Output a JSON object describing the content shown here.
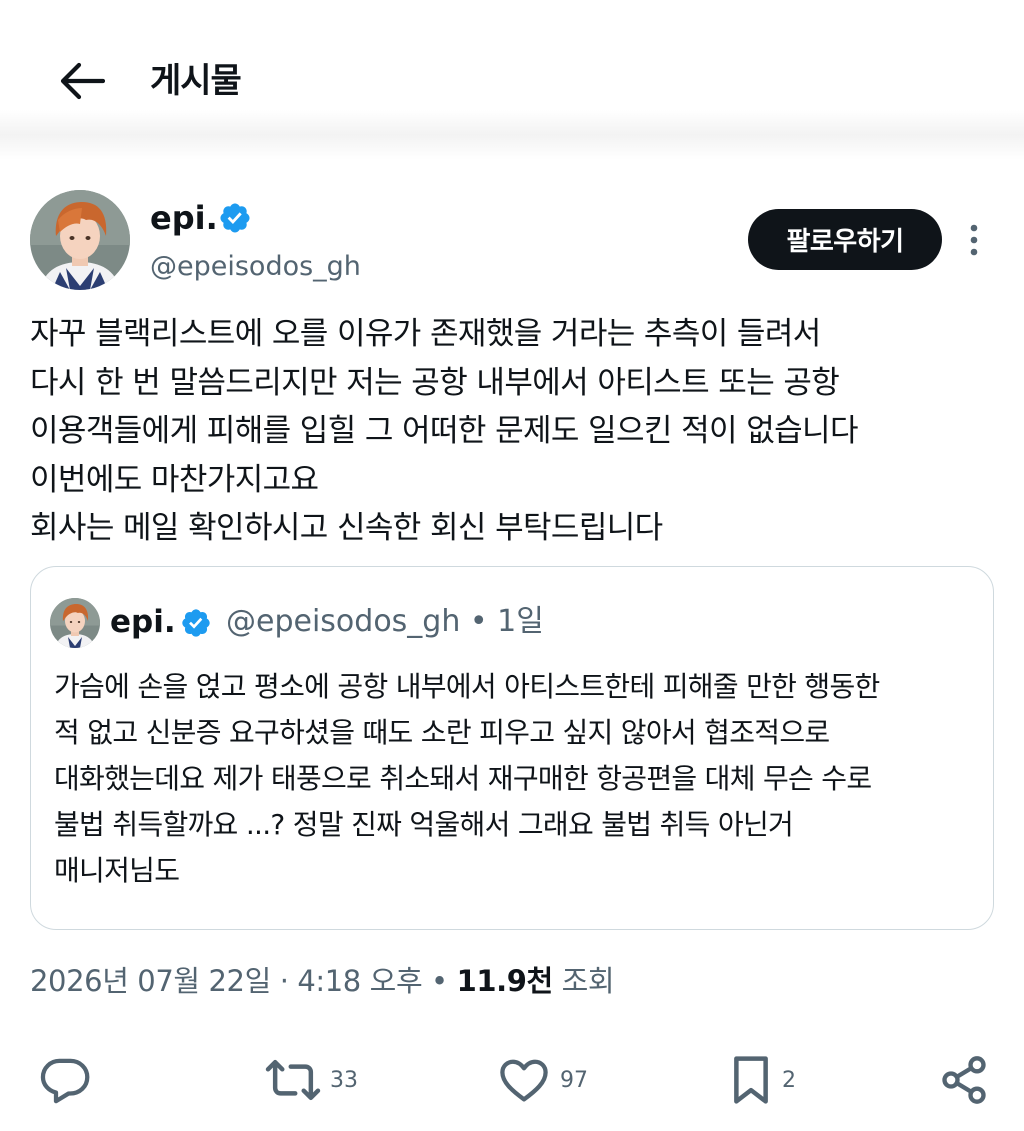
{
  "header": {
    "title": "게시물"
  },
  "author": {
    "display_name": "epi.",
    "handle": "@epeisodos_gh"
  },
  "follow_label": "팔로우하기",
  "tweet_lines": [
    "자꾸 블랙리스트에 오를 이유가 존재했을 거라는 추측이 들려서",
    "다시 한 번 말씀드리지만 저는 공항 내부에서 아티스트 또는 공항",
    "이용객들에게 피해를 입힐 그 어떠한 문제도 일으킨 적이 없습니다",
    "이번에도 마찬가지고요",
    "회사는 메일 확인하시고 신속한 회신 부탁드립니다"
  ],
  "quote": {
    "display_name": "epi.",
    "handle_time": "@epeisodos_gh • 1일",
    "lines": [
      "가슴에 손을 얹고 평소에 공항 내부에서 아티스트한테 피해줄 만한 행동한",
      "적 없고 신분증 요구하셨을 때도 소란 피우고 싶지 않아서 협조적으로",
      "대화했는데요 제가 태풍으로 취소돼서 재구매한 항공편을 대체 무슨 수로",
      "불법 취득할까요 ...? 정말 진짜 억울해서 그래요 불법 취득 아닌거",
      "매니저님도"
    ]
  },
  "meta": {
    "timestamp": "2026년 07월 22일 · 4:18 오후 • ",
    "views_count": "11.9천",
    "views_label": " 조회"
  },
  "actions": {
    "retweets": "33",
    "likes": "97",
    "bookmarks": "2"
  },
  "icons": {
    "back": "arrow-left-icon",
    "verified": "verified-badge-icon",
    "more": "more-vertical-icon",
    "reply": "reply-icon",
    "retweet": "retweet-icon",
    "like": "heart-icon",
    "bookmark": "bookmark-icon",
    "share": "share-icon"
  },
  "colors": {
    "verified": "#1d9bf0",
    "text": "#0f1419",
    "secondary": "#536471",
    "border": "#cfd9de"
  }
}
